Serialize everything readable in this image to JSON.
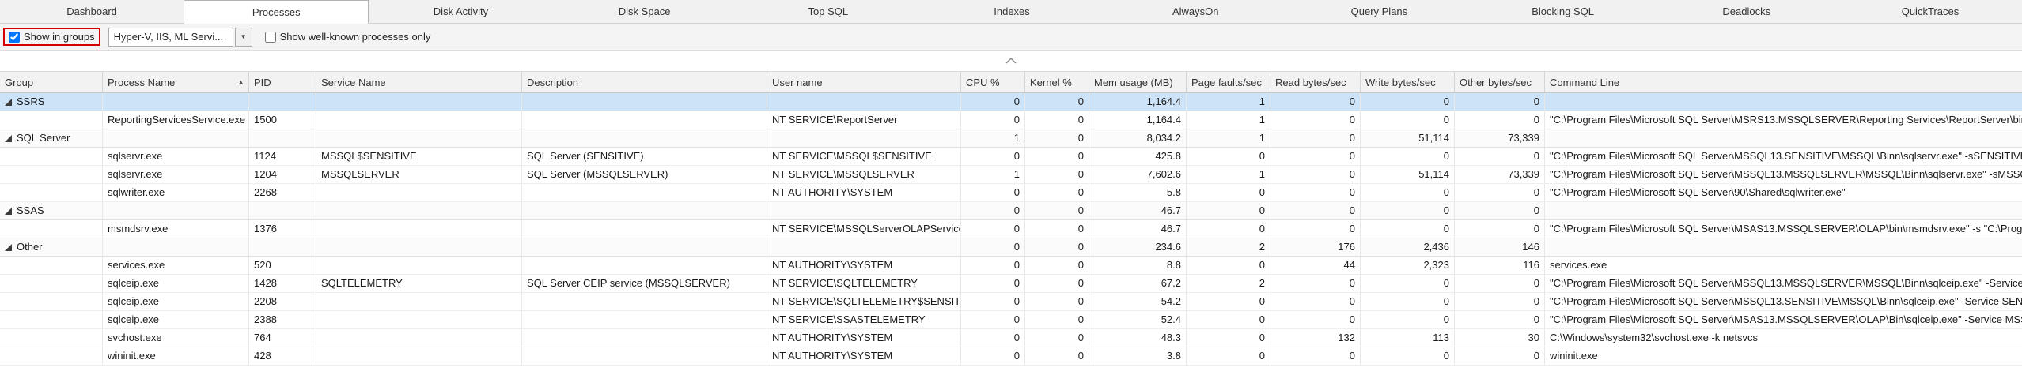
{
  "tabs": [
    {
      "label": "Dashboard",
      "active": false
    },
    {
      "label": "Processes",
      "active": true
    },
    {
      "label": "Disk Activity",
      "active": false
    },
    {
      "label": "Disk Space",
      "active": false
    },
    {
      "label": "Top SQL",
      "active": false
    },
    {
      "label": "Indexes",
      "active": false
    },
    {
      "label": "AlwaysOn",
      "active": false
    },
    {
      "label": "Query Plans",
      "active": false
    },
    {
      "label": "Blocking SQL",
      "active": false
    },
    {
      "label": "Deadlocks",
      "active": false
    },
    {
      "label": "QuickTraces",
      "active": false
    }
  ],
  "toolbar": {
    "show_in_groups": {
      "label": "Show in groups",
      "checked": true,
      "highlighted": true,
      "highlight_color": "#d40000"
    },
    "process_filter_dropdown": {
      "value": "Hyper-V, IIS, ML Servi...",
      "expanded": false
    },
    "show_well_known": {
      "label": "Show well-known processes only",
      "checked": false
    }
  },
  "grid": {
    "columns": [
      {
        "key": "group",
        "label": "Group"
      },
      {
        "key": "process_name",
        "label": "Process Name",
        "sort": "asc"
      },
      {
        "key": "pid",
        "label": "PID"
      },
      {
        "key": "service_name",
        "label": "Service Name"
      },
      {
        "key": "description",
        "label": "Description"
      },
      {
        "key": "user_name",
        "label": "User name"
      },
      {
        "key": "cpu",
        "label": "CPU %",
        "numeric": true
      },
      {
        "key": "kernel",
        "label": "Kernel %",
        "numeric": true
      },
      {
        "key": "mem",
        "label": "Mem usage (MB)",
        "numeric": true
      },
      {
        "key": "page_faults",
        "label": "Page faults/sec",
        "numeric": true
      },
      {
        "key": "read",
        "label": "Read bytes/sec",
        "numeric": true
      },
      {
        "key": "write",
        "label": "Write bytes/sec",
        "numeric": true
      },
      {
        "key": "other",
        "label": "Other bytes/sec",
        "numeric": true
      },
      {
        "key": "command_line",
        "label": "Command Line"
      }
    ],
    "rows": [
      {
        "type": "group",
        "selected": true,
        "cells": {
          "group": "SSRS",
          "cpu": "0",
          "kernel": "0",
          "mem": "1,164.4",
          "page_faults": "1",
          "read": "0",
          "write": "0",
          "other": "0"
        }
      },
      {
        "type": "data",
        "cells": {
          "process_name": "ReportingServicesService.exe",
          "pid": "1500",
          "service_name": "",
          "description": "",
          "user_name": "NT SERVICE\\ReportServer",
          "cpu": "0",
          "kernel": "0",
          "mem": "1,164.4",
          "page_faults": "1",
          "read": "0",
          "write": "0",
          "other": "0",
          "command_line": "\"C:\\Program Files\\Microsoft SQL Server\\MSRS13.MSSQLSERVER\\Reporting Services\\ReportServer\\bin\\ReportingServicesService.exe\""
        }
      },
      {
        "type": "group",
        "cells": {
          "group": "SQL Server",
          "cpu": "1",
          "kernel": "0",
          "mem": "8,034.2",
          "page_faults": "1",
          "read": "0",
          "write": "51,114",
          "other": "73,339"
        }
      },
      {
        "type": "data",
        "cells": {
          "process_name": "sqlservr.exe",
          "pid": "1124",
          "service_name": "MSSQL$SENSITIVE",
          "description": "SQL Server (SENSITIVE)",
          "user_name": "NT SERVICE\\MSSQL$SENSITIVE",
          "cpu": "0",
          "kernel": "0",
          "mem": "425.8",
          "page_faults": "0",
          "read": "0",
          "write": "0",
          "other": "0",
          "command_line": "\"C:\\Program Files\\Microsoft SQL Server\\MSSQL13.SENSITIVE\\MSSQL\\Binn\\sqlservr.exe\" -sSENSITIVE"
        }
      },
      {
        "type": "data",
        "cells": {
          "process_name": "sqlservr.exe",
          "pid": "1204",
          "service_name": "MSSQLSERVER",
          "description": "SQL Server (MSSQLSERVER)",
          "user_name": "NT SERVICE\\MSSQLSERVER",
          "cpu": "1",
          "kernel": "0",
          "mem": "7,602.6",
          "page_faults": "1",
          "read": "0",
          "write": "51,114",
          "other": "73,339",
          "command_line": "\"C:\\Program Files\\Microsoft SQL Server\\MSSQL13.MSSQLSERVER\\MSSQL\\Binn\\sqlservr.exe\" -sMSSQLSERVER"
        }
      },
      {
        "type": "data",
        "cells": {
          "process_name": "sqlwriter.exe",
          "pid": "2268",
          "service_name": "",
          "description": "",
          "user_name": "NT AUTHORITY\\SYSTEM",
          "cpu": "0",
          "kernel": "0",
          "mem": "5.8",
          "page_faults": "0",
          "read": "0",
          "write": "0",
          "other": "0",
          "command_line": "\"C:\\Program Files\\Microsoft SQL Server\\90\\Shared\\sqlwriter.exe\""
        }
      },
      {
        "type": "group",
        "cells": {
          "group": "SSAS",
          "cpu": "0",
          "kernel": "0",
          "mem": "46.7",
          "page_faults": "0",
          "read": "0",
          "write": "0",
          "other": "0"
        }
      },
      {
        "type": "data",
        "cells": {
          "process_name": "msmdsrv.exe",
          "pid": "1376",
          "service_name": "",
          "description": "",
          "user_name": "NT SERVICE\\MSSQLServerOLAPService",
          "cpu": "0",
          "kernel": "0",
          "mem": "46.7",
          "page_faults": "0",
          "read": "0",
          "write": "0",
          "other": "0",
          "command_line": "\"C:\\Program Files\\Microsoft SQL Server\\MSAS13.MSSQLSERVER\\OLAP\\bin\\msmdsrv.exe\" -s \"C:\\Program Files\\Microsoft SQL Server\\MSAS13.MSSQLSERVER\\OLAP\\Config\""
        }
      },
      {
        "type": "group",
        "cells": {
          "group": "Other",
          "cpu": "0",
          "kernel": "0",
          "mem": "234.6",
          "page_faults": "2",
          "read": "176",
          "write": "2,436",
          "other": "146"
        }
      },
      {
        "type": "data",
        "cells": {
          "process_name": "services.exe",
          "pid": "520",
          "service_name": "",
          "description": "",
          "user_name": "NT AUTHORITY\\SYSTEM",
          "cpu": "0",
          "kernel": "0",
          "mem": "8.8",
          "page_faults": "0",
          "read": "44",
          "write": "2,323",
          "other": "116",
          "command_line": "services.exe"
        }
      },
      {
        "type": "data",
        "cells": {
          "process_name": "sqlceip.exe",
          "pid": "1428",
          "service_name": "SQLTELEMETRY",
          "description": "SQL Server CEIP service (MSSQLSERVER)",
          "user_name": "NT SERVICE\\SQLTELEMETRY",
          "cpu": "0",
          "kernel": "0",
          "mem": "67.2",
          "page_faults": "2",
          "read": "0",
          "write": "0",
          "other": "0",
          "command_line": "\"C:\\Program Files\\Microsoft SQL Server\\MSSQL13.MSSQLSERVER\\MSSQL\\Binn\\sqlceip.exe\" -Service"
        }
      },
      {
        "type": "data",
        "cells": {
          "process_name": "sqlceip.exe",
          "pid": "2208",
          "service_name": "",
          "description": "",
          "user_name": "NT SERVICE\\SQLTELEMETRY$SENSITIVE",
          "cpu": "0",
          "kernel": "0",
          "mem": "54.2",
          "page_faults": "0",
          "read": "0",
          "write": "0",
          "other": "0",
          "command_line": "\"C:\\Program Files\\Microsoft SQL Server\\MSSQL13.SENSITIVE\\MSSQL\\Binn\\sqlceip.exe\" -Service SENSITIVE"
        }
      },
      {
        "type": "data",
        "cells": {
          "process_name": "sqlceip.exe",
          "pid": "2388",
          "service_name": "",
          "description": "",
          "user_name": "NT SERVICE\\SSASTELEMETRY",
          "cpu": "0",
          "kernel": "0",
          "mem": "52.4",
          "page_faults": "0",
          "read": "0",
          "write": "0",
          "other": "0",
          "command_line": "\"C:\\Program Files\\Microsoft SQL Server\\MSAS13.MSSQLSERVER\\OLAP\\Bin\\sqlceip.exe\" -Service MSSQLServerOLAPService"
        }
      },
      {
        "type": "data",
        "cells": {
          "process_name": "svchost.exe",
          "pid": "764",
          "service_name": "",
          "description": "",
          "user_name": "NT AUTHORITY\\SYSTEM",
          "cpu": "0",
          "kernel": "0",
          "mem": "48.3",
          "page_faults": "0",
          "read": "132",
          "write": "113",
          "other": "30",
          "command_line": "C:\\Windows\\system32\\svchost.exe -k netsvcs"
        }
      },
      {
        "type": "data",
        "cells": {
          "process_name": "wininit.exe",
          "pid": "428",
          "service_name": "",
          "description": "",
          "user_name": "NT AUTHORITY\\SYSTEM",
          "cpu": "0",
          "kernel": "0",
          "mem": "3.8",
          "page_faults": "0",
          "read": "0",
          "write": "0",
          "other": "0",
          "command_line": "wininit.exe"
        }
      }
    ]
  }
}
